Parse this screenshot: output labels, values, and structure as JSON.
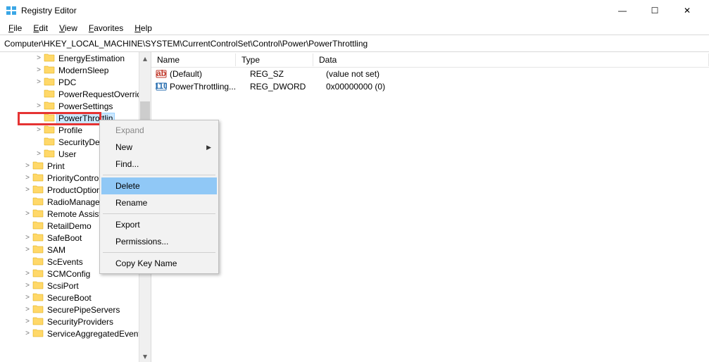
{
  "window": {
    "title": "Registry Editor",
    "controls": {
      "min": "—",
      "max": "☐",
      "close": "✕"
    }
  },
  "menubar": [
    "File",
    "Edit",
    "View",
    "Favorites",
    "Help"
  ],
  "addressbar": "Computer\\HKEY_LOCAL_MACHINE\\SYSTEM\\CurrentControlSet\\Control\\Power\\PowerThrottling",
  "tree": {
    "items": [
      {
        "indent": 3,
        "exp": ">",
        "label": "EnergyEstimation"
      },
      {
        "indent": 3,
        "exp": ">",
        "label": "ModernSleep"
      },
      {
        "indent": 3,
        "exp": ">",
        "label": "PDC"
      },
      {
        "indent": 3,
        "exp": "",
        "label": "PowerRequestOverride"
      },
      {
        "indent": 3,
        "exp": ">",
        "label": "PowerSettings"
      },
      {
        "indent": 3,
        "exp": "",
        "label": "PowerThrottlin",
        "selected": true
      },
      {
        "indent": 3,
        "exp": ">",
        "label": "Profile"
      },
      {
        "indent": 3,
        "exp": "",
        "label": "SecurityDescrip"
      },
      {
        "indent": 3,
        "exp": ">",
        "label": "User"
      },
      {
        "indent": 2,
        "exp": ">",
        "label": "Print"
      },
      {
        "indent": 2,
        "exp": ">",
        "label": "PriorityControl"
      },
      {
        "indent": 2,
        "exp": ">",
        "label": "ProductOptions"
      },
      {
        "indent": 2,
        "exp": "",
        "label": "RadioManagemen"
      },
      {
        "indent": 2,
        "exp": ">",
        "label": "Remote Assistanc"
      },
      {
        "indent": 2,
        "exp": "",
        "label": "RetailDemo"
      },
      {
        "indent": 2,
        "exp": ">",
        "label": "SafeBoot"
      },
      {
        "indent": 2,
        "exp": ">",
        "label": "SAM"
      },
      {
        "indent": 2,
        "exp": "",
        "label": "ScEvents"
      },
      {
        "indent": 2,
        "exp": ">",
        "label": "SCMConfig"
      },
      {
        "indent": 2,
        "exp": ">",
        "label": "ScsiPort"
      },
      {
        "indent": 2,
        "exp": ">",
        "label": "SecureBoot"
      },
      {
        "indent": 2,
        "exp": ">",
        "label": "SecurePipeServers"
      },
      {
        "indent": 2,
        "exp": ">",
        "label": "SecurityProviders"
      },
      {
        "indent": 2,
        "exp": ">",
        "label": "ServiceAggregatedEvents"
      }
    ]
  },
  "list": {
    "columns": {
      "name": "Name",
      "type": "Type",
      "data": "Data"
    },
    "rows": [
      {
        "icon": "string",
        "name": "(Default)",
        "type": "REG_SZ",
        "data": "(value not set)"
      },
      {
        "icon": "binary",
        "name": "PowerThrottling...",
        "type": "REG_DWORD",
        "data": "0x00000000 (0)"
      }
    ]
  },
  "context_menu": {
    "items": [
      {
        "label": "Expand",
        "disabled": true
      },
      {
        "label": "New",
        "submenu": true
      },
      {
        "label": "Find..."
      },
      {
        "sep": true
      },
      {
        "label": "Delete",
        "hover": true
      },
      {
        "label": "Rename"
      },
      {
        "sep": true
      },
      {
        "label": "Export"
      },
      {
        "label": "Permissions..."
      },
      {
        "sep": true
      },
      {
        "label": "Copy Key Name"
      }
    ]
  }
}
